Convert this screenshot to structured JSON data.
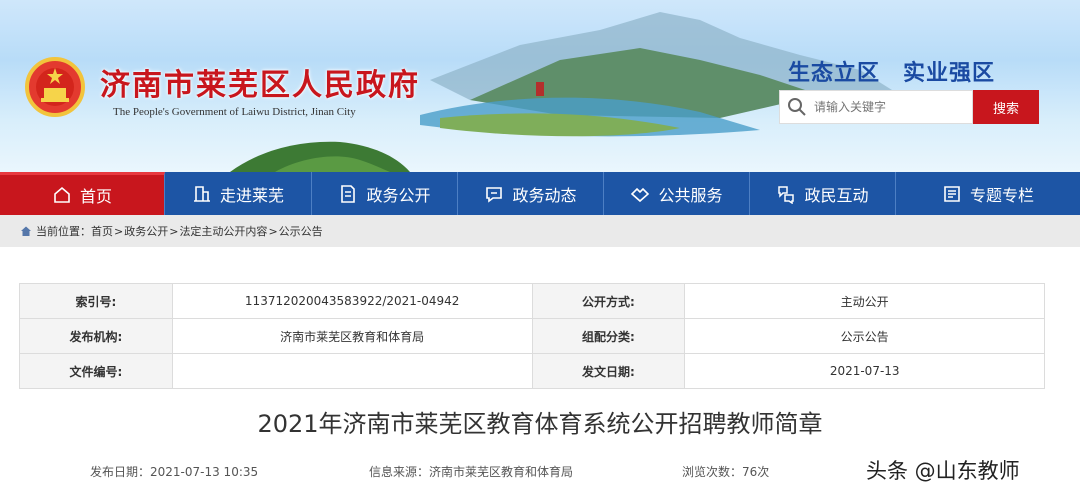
{
  "header": {
    "site_title": "济南市莱芜区人民政府",
    "site_subtitle": "The People's Government of Laiwu District, Jinan City",
    "slogan": "生态立区　实业强区",
    "search_placeholder": "请输入关键字",
    "search_button": "搜索"
  },
  "nav": {
    "items": [
      {
        "label": "首页",
        "icon": "home-icon",
        "active": true
      },
      {
        "label": "走进莱芜",
        "icon": "building-icon"
      },
      {
        "label": "政务公开",
        "icon": "document-icon"
      },
      {
        "label": "政务动态",
        "icon": "chat-icon"
      },
      {
        "label": "公共服务",
        "icon": "handshake-icon"
      },
      {
        "label": "政民互动",
        "icon": "interaction-icon"
      },
      {
        "label": "专题专栏",
        "icon": "list-icon"
      }
    ]
  },
  "breadcrumb": {
    "prefix": "当前位置：",
    "items": [
      "首页",
      "政务公开",
      "法定主动公开内容",
      "公示公告"
    ],
    "separator": ">"
  },
  "info_table": {
    "rows": [
      [
        {
          "label": "索引号:",
          "value": "11371202004358392​2/2021-04942"
        },
        {
          "label": "公开方式:",
          "value": "主动公开"
        }
      ],
      [
        {
          "label": "发布机构:",
          "value": "济南市莱芜区教育和体育局"
        },
        {
          "label": "组配分类:",
          "value": "公示公告"
        }
      ],
      [
        {
          "label": "文件编号:",
          "value": ""
        },
        {
          "label": "发文日期:",
          "value": "2021-07-13"
        }
      ]
    ]
  },
  "article": {
    "title": "2021年济南市莱芜区教育体育系统公开招聘教师简章",
    "publish_date": "发布日期：2021-07-13 10:35",
    "source": "信息来源：济南市莱芜区教育和体育局",
    "views": "浏览次数：76次"
  },
  "watermark": "头条 @山东教师",
  "colors": {
    "brand_red": "#c8161d",
    "nav_blue": "#1d55a5",
    "slogan_blue": "#1a4aa2"
  }
}
